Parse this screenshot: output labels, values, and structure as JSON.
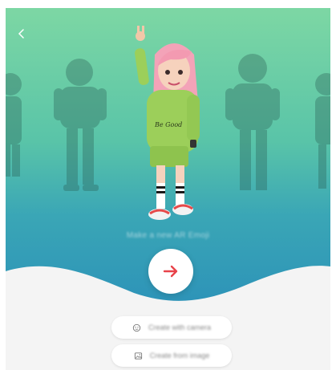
{
  "screen": {
    "subtitle": "Make a new AR Emoji"
  },
  "icons": {
    "back": "chevron-left-icon",
    "next": "arrow-right-icon",
    "camera_option": "face-icon",
    "image_option": "image-icon"
  },
  "options": {
    "camera_label": "Create with camera",
    "image_label": "Create from image"
  },
  "colors": {
    "accent": "#e8434a",
    "gradient_top": "#7dd7a4",
    "gradient_bottom": "#2d93b8"
  }
}
